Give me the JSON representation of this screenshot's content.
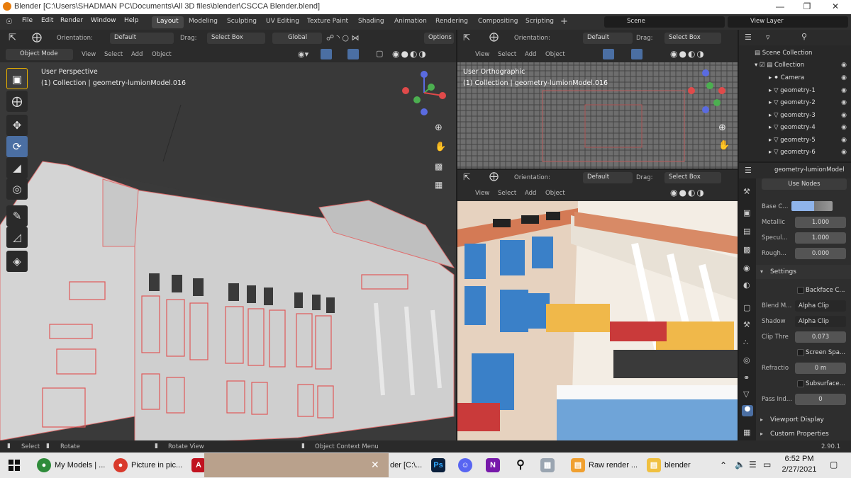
{
  "window": {
    "title": "Blender [C:\\Users\\SHADMAN PC\\Documents\\All 3D files\\blender\\CSCCA Blender.blend]"
  },
  "menu": [
    "File",
    "Edit",
    "Render",
    "Window",
    "Help"
  ],
  "workspaces": [
    "Layout",
    "Modeling",
    "Sculpting",
    "UV Editing",
    "Texture Paint",
    "Shading",
    "Animation",
    "Rendering",
    "Compositing",
    "Scripting"
  ],
  "active_workspace": "Layout",
  "scene": "Scene",
  "view_layer": "View Layer",
  "tool_header": {
    "orientation_label": "Orientation:",
    "orientation_value": "Default",
    "drag_label": "Drag:",
    "drag_value": "Select Box",
    "transform": "Global",
    "options": "Options"
  },
  "viewport_main": {
    "mode": "Object Mode",
    "menus": [
      "View",
      "Select",
      "Add",
      "Object"
    ],
    "view_name": "User Perspective",
    "collection_info": "(1) Collection | geometry-lumionModel.016"
  },
  "viewport_top_right": {
    "orientation_label": "Orientation:",
    "orientation_value": "Default",
    "drag_label": "Drag:",
    "drag_value": "Select Box",
    "menus": [
      "View",
      "Select",
      "Add",
      "Object"
    ],
    "view_name": "User Orthographic",
    "collection_info": "(1) Collection | geometry-lumionModel.016"
  },
  "viewport_bottom_right": {
    "orientation_label": "Orientation:",
    "orientation_value": "Default",
    "drag_label": "Drag:",
    "drag_value": "Select Box",
    "menus": [
      "View",
      "Select",
      "Add",
      "Object"
    ]
  },
  "outliner": {
    "root": "Scene Collection",
    "collection": "Collection",
    "items": [
      "Camera",
      "geometry-1",
      "geometry-2",
      "geometry-3",
      "geometry-4",
      "geometry-5",
      "geometry-6"
    ]
  },
  "properties": {
    "object": "geometry-lumionModel",
    "use_nodes": "Use Nodes",
    "base_color_label": "Base C...",
    "metallic_label": "Metallic",
    "metallic": "1.000",
    "specular_label": "Specul...",
    "specular": "1.000",
    "roughness_label": "Rough...",
    "roughness": "0.000",
    "settings": "Settings",
    "backface": "Backface C...",
    "blend_label": "Blend M...",
    "blend": "Alpha Clip",
    "shadow_label": "Shadow",
    "shadow": "Alpha Clip",
    "clip_label": "Clip Thre",
    "clip": "0.073",
    "screen_space": "Screen Spa...",
    "refraction_label": "Refractio",
    "refraction": "0 m",
    "subsurface": "Subsurface...",
    "pass_label": "Pass Ind...",
    "pass": "0",
    "viewport_display": "Viewport Display",
    "custom_props": "Custom Properties"
  },
  "status": {
    "select": "Select",
    "rotate": "Rotate",
    "rotate_view": "Rotate View",
    "context_menu": "Object Context Menu",
    "version": "2.90.1"
  },
  "taskbar": {
    "items": [
      "My Models | ...",
      "Picture in pic...",
      "der [C:\\...",
      "Raw render ...",
      "blender"
    ],
    "time": "6:52 PM",
    "date": "2/27/2021"
  },
  "colors": {
    "accent": "#4b6fa3",
    "header": "#303030",
    "viewport_bg": "#393939",
    "base_color": "#8fb4ea"
  }
}
